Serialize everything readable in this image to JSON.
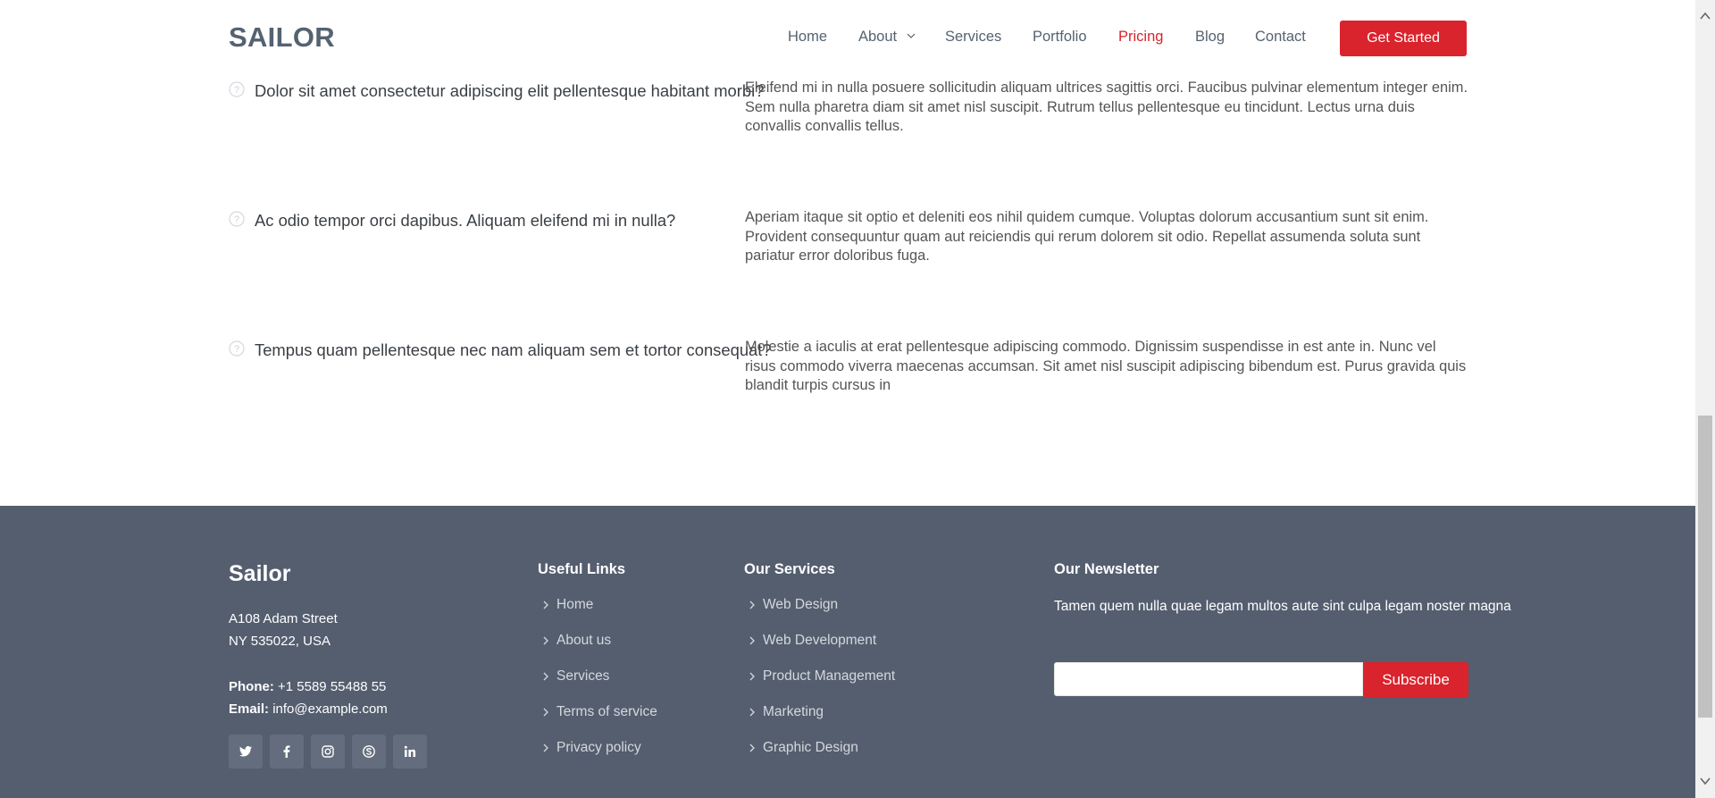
{
  "header": {
    "logo": "SAILOR",
    "nav": [
      {
        "label": "Home"
      },
      {
        "label": "About"
      },
      {
        "label": "Services"
      },
      {
        "label": "Portfolio"
      },
      {
        "label": "Pricing",
        "active": true
      },
      {
        "label": "Blog"
      },
      {
        "label": "Contact"
      }
    ],
    "cta": "Get Started"
  },
  "faq": [
    {
      "question": "Dolor sit amet consectetur adipiscing elit pellentesque habitant morbi?",
      "answer": "Eleifend mi in nulla posuere sollicitudin aliquam ultrices sagittis orci. Faucibus pulvinar elementum integer enim. Sem nulla pharetra diam sit amet nisl suscipit. Rutrum tellus pellentesque eu tincidunt. Lectus urna duis convallis convallis tellus."
    },
    {
      "question": "Ac odio tempor orci dapibus. Aliquam eleifend mi in nulla?",
      "answer": "Aperiam itaque sit optio et deleniti eos nihil quidem cumque. Voluptas dolorum accusantium sunt sit enim. Provident consequuntur quam aut reiciendis qui rerum dolorem sit odio. Repellat assumenda soluta sunt pariatur error doloribus fuga."
    },
    {
      "question": "Tempus quam pellentesque nec nam aliquam sem et tortor consequat?",
      "answer": "Molestie a iaculis at erat pellentesque adipiscing commodo. Dignissim suspendisse in est ante in. Nunc vel risus commodo viverra maecenas accumsan. Sit amet nisl suscipit adipiscing bibendum est. Purus gravida quis blandit turpis cursus in"
    }
  ],
  "footer": {
    "brand": "Sailor",
    "address_line1": "A108 Adam Street",
    "address_line2": "NY 535022, USA",
    "phone_label": "Phone:",
    "phone": "+1 5589 55488 55",
    "email_label": "Email:",
    "email": "info@example.com",
    "socials": [
      "twitter-icon",
      "facebook-icon",
      "instagram-icon",
      "skype-icon",
      "linkedin-icon"
    ],
    "useful_links_title": "Useful Links",
    "useful_links": [
      "Home",
      "About us",
      "Services",
      "Terms of service",
      "Privacy policy"
    ],
    "services_title": "Our Services",
    "services": [
      "Web Design",
      "Web Development",
      "Product Management",
      "Marketing",
      "Graphic Design"
    ],
    "newsletter_title": "Our Newsletter",
    "newsletter_text": "Tamen quem nulla quae legam multos aute sint culpa legam noster magna",
    "newsletter_input_value": "",
    "subscribe": "Subscribe"
  },
  "colors": {
    "accent": "#d9232d",
    "footer_bg": "#545e6f",
    "nav_text": "#556270"
  }
}
